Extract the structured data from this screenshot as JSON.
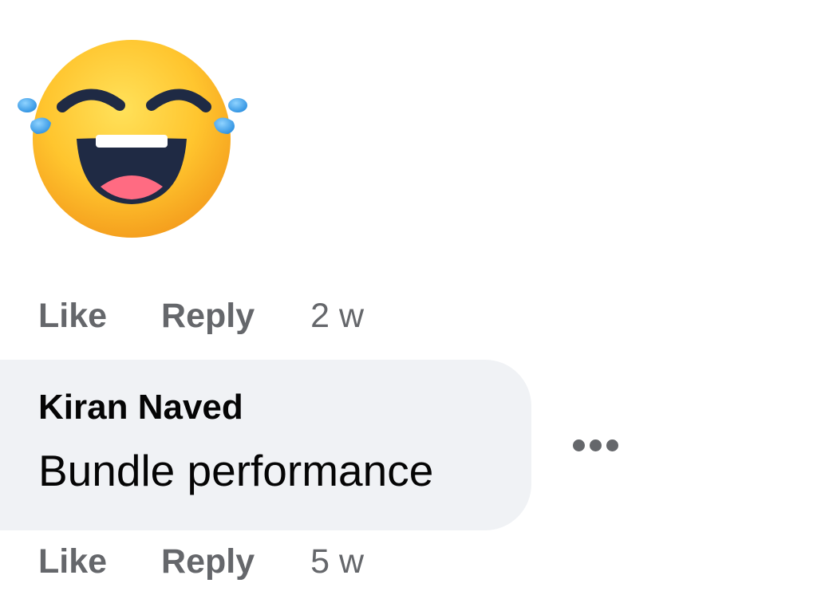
{
  "reaction_sticker": {
    "icon": "laughing-tears-emoji-icon"
  },
  "first_comment_actions": {
    "like_label": "Like",
    "reply_label": "Reply",
    "timestamp": "2 w"
  },
  "comment": {
    "author": "Kiran Naved",
    "text": "Bundle performance",
    "more_icon": "more-options-icon"
  },
  "second_comment_actions": {
    "like_label": "Like",
    "reply_label": "Reply",
    "timestamp": "5 w"
  },
  "colors": {
    "bubble_background": "#f0f2f5",
    "secondary_text": "#65676b",
    "primary_text": "#050505"
  }
}
